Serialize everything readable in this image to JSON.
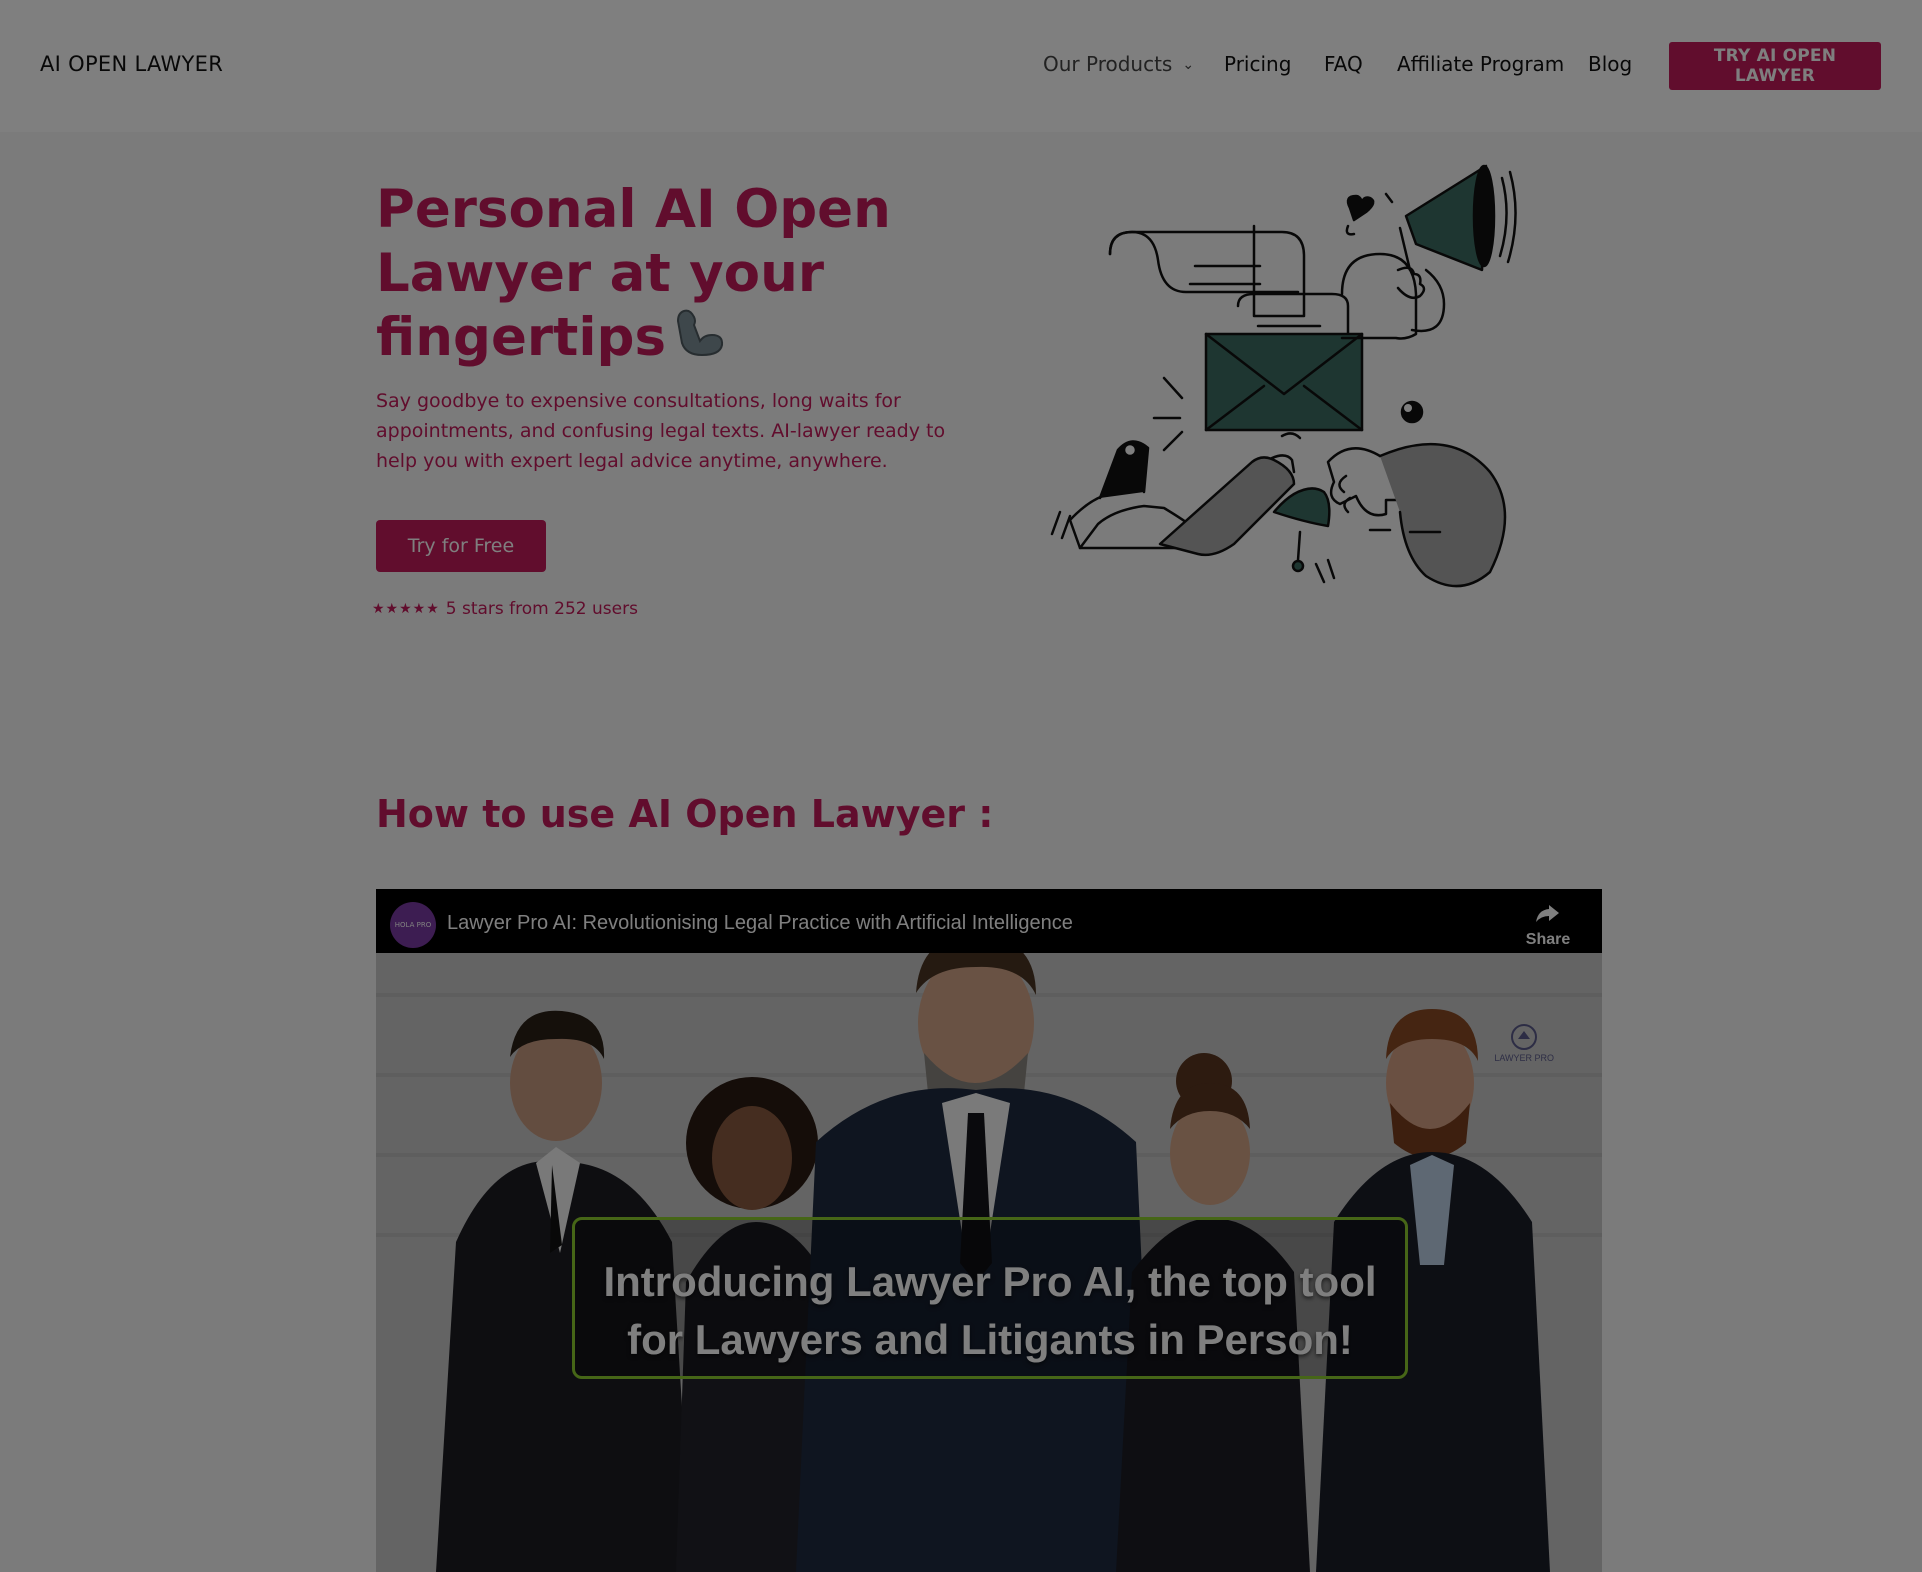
{
  "header": {
    "logo": "AI OPEN LAWYER",
    "nav": {
      "products": "Our Products",
      "pricing": "Pricing",
      "faq": "FAQ",
      "affiliate": "Affiliate Program",
      "blog": "Blog"
    },
    "cta": "TRY AI OPEN LAWYER"
  },
  "hero": {
    "title_line1": "Personal AI Open",
    "title_line2": "Lawyer at your",
    "title_line3": "fingertips",
    "description": "Say goodbye to expensive consultations, long waits for appointments, and confusing legal texts. AI-lawyer ready to help you with expert legal advice anytime, anywhere.",
    "button": "Try for Free",
    "stars": "★★★★★",
    "rating_text": "5 stars from 252 users"
  },
  "how_to": {
    "title": "How to use AI Open Lawyer :"
  },
  "video": {
    "title": "Lawyer Pro AI: Revolutionising Legal Practice with Artificial Intelligence",
    "share_label": "Share",
    "channel_label": "HOLA PRO",
    "watermark": "LAWYER PRO",
    "caption_line1": "Introducing Lawyer Pro AI, the top tool",
    "caption_line2": "for Lawyers and Litigants in Person!"
  },
  "colors": {
    "brand": "#c21a5a",
    "illustration_accent": "#3c6d62",
    "caption_frame": "#8ccc2f"
  }
}
